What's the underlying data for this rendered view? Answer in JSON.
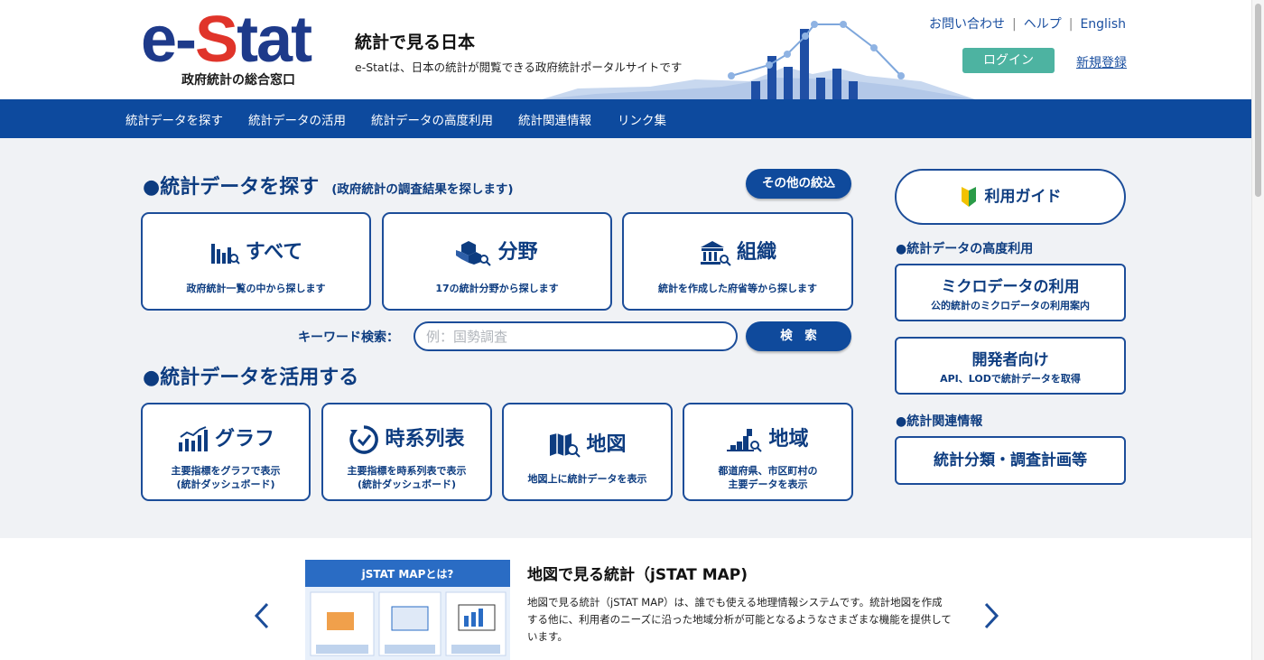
{
  "header": {
    "logo": "e-Stat",
    "logo_sub": "政府統計の総合窓口",
    "tagline_title": "統計で見る日本",
    "tagline_sub": "e-Statは、日本の統計が閲覧できる政府統計ポータルサイトです",
    "links": [
      "お問い合わせ",
      "ヘルプ",
      "English"
    ],
    "login": "ログイン",
    "register": "新規登録"
  },
  "nav": [
    "統計データを探す",
    "統計データの活用",
    "統計データの高度利用",
    "統計関連情報",
    "リンク集"
  ],
  "search_section": {
    "title": "●統計データを探す",
    "note": "(政府統計の調査結果を探します)",
    "filter_button": "その他の絞込",
    "cards": [
      {
        "title": "すべて",
        "desc": "政府統計一覧の中から探します",
        "icon": "bar-chart-search-icon"
      },
      {
        "title": "分野",
        "desc": "17の統計分野から探します",
        "icon": "cubes-search-icon"
      },
      {
        "title": "組織",
        "desc": "統計を作成した府省等から探します",
        "icon": "building-search-icon"
      }
    ],
    "keyword_label": "キーワード検索：",
    "keyword_placeholder": "例：国勢調査",
    "search_button": "検　索"
  },
  "use_section": {
    "title": "●統計データを活用する",
    "cards": [
      {
        "title": "グラフ",
        "desc1": "主要指標をグラフで表示",
        "desc2": "(統計ダッシュボード)",
        "icon": "graph-icon"
      },
      {
        "title": "時系列表",
        "desc1": "主要指標を時系列表で表示",
        "desc2": "(統計ダッシュボード)",
        "icon": "clock-icon"
      },
      {
        "title": "地図",
        "desc1": "地図上に統計データを表示",
        "desc2": "",
        "icon": "map-search-icon"
      },
      {
        "title": "地域",
        "desc1": "都道府県、市区町村の",
        "desc2": "主要データを表示",
        "icon": "region-search-icon"
      }
    ]
  },
  "sidebar": {
    "guide": "利用ガイド",
    "advanced_heading": "●統計データの高度利用",
    "micro_title": "ミクロデータの利用",
    "micro_sub": "公的統計のミクロデータの利用案内",
    "dev_title": "開発者向け",
    "dev_sub": "API、LODで統計データを取得",
    "related_heading": "●統計関連情報",
    "classification": "統計分類・調査計画等"
  },
  "promo": {
    "image_caption": "jSTAT MAPとは?",
    "title": "地図で見る統計（jSTAT MAP)",
    "text": "地図で見る統計（jSTAT MAP）は、誰でも使える地理情報システムです。統計地図を作成する他に、利用者のニーズに沿った地域分析が可能となるようなさまざまな機能を提供しています。"
  },
  "colors": {
    "brand_blue": "#0d4a9e",
    "logo_red": "#e0342a",
    "login_green": "#4db3a1"
  }
}
